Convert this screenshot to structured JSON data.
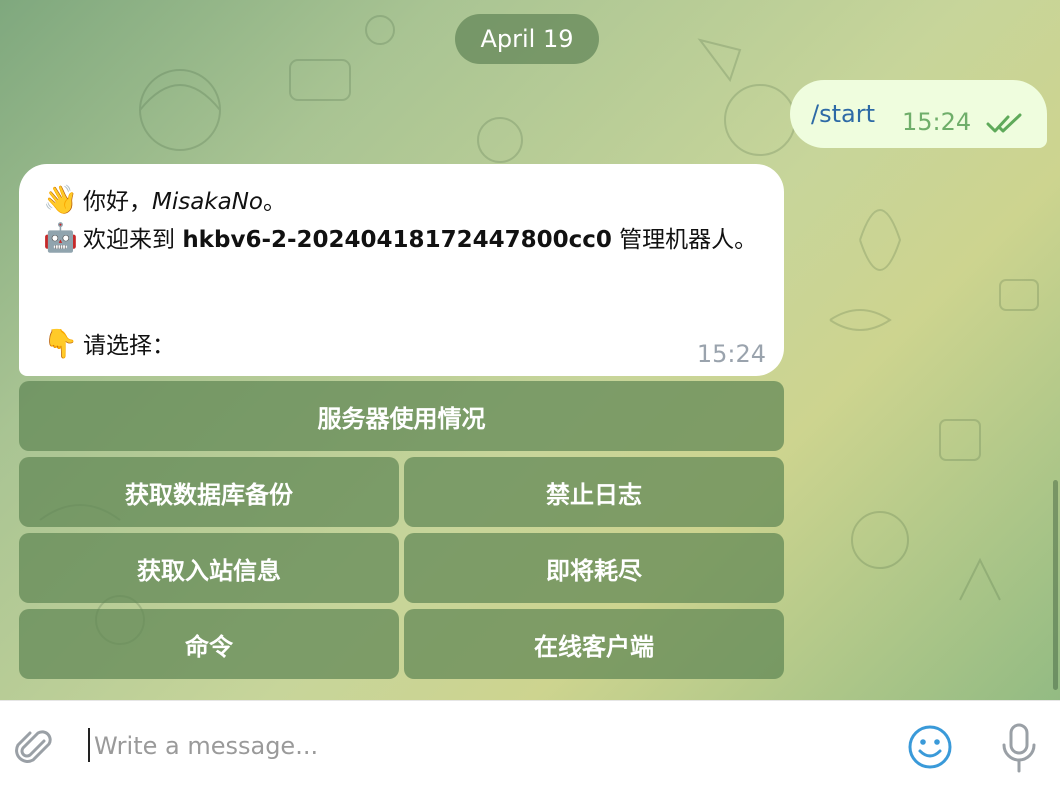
{
  "date_separator": "April 19",
  "outgoing": {
    "text": "/start",
    "time": "15:24",
    "status_icon": "double-check-icon"
  },
  "incoming": {
    "greeting_emoji": "👋",
    "greeting_prefix": "你好，",
    "greeting_name": "MisakaNo",
    "greeting_suffix": "。",
    "welcome_emoji": "🤖",
    "welcome_prefix": "欢迎来到 ",
    "welcome_bot": "hkbv6-2-20240418172447800cc0",
    "welcome_suffix": " 管理机器人。",
    "prompt_emoji": "👇",
    "prompt_text": "请选择：",
    "time": "15:24"
  },
  "keyboard": {
    "server_usage": "服务器使用情况",
    "db_backup": "获取数据库备份",
    "disable_logs": "禁止日志",
    "inbound_info": "获取入站信息",
    "depleting": "即将耗尽",
    "commands": "命令",
    "online_clients": "在线客户端"
  },
  "composer": {
    "placeholder": "Write a message..."
  },
  "icons": {
    "attach": "paperclip-icon",
    "emoji": "smiley-icon",
    "voice": "microphone-icon"
  },
  "colors": {
    "outgoing_bubble": "#effdde",
    "incoming_bubble": "#ffffff",
    "keyboard_button": "#5f8755",
    "link_text": "#2d6aa6",
    "accent_blue": "#3a9ad9"
  }
}
